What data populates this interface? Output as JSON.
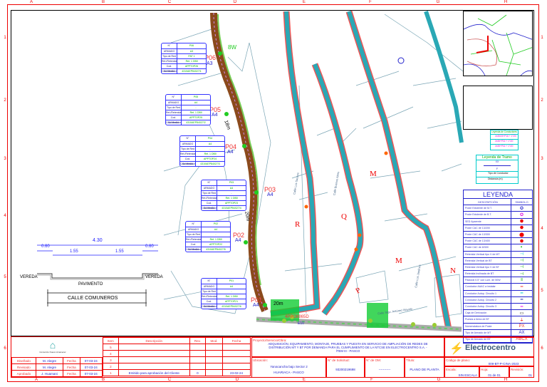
{
  "grid": {
    "columns": [
      "A",
      "B",
      "C",
      "D",
      "E",
      "F",
      "G",
      "H"
    ],
    "rows": [
      "1",
      "2",
      "3",
      "4",
      "5",
      "6"
    ]
  },
  "section": {
    "total": "4.30",
    "left_sidewalk": "0.60",
    "lane_left": "1.55",
    "lane_right": "1.55",
    "right_sidewalk": "0.60",
    "vereda_left": "VEREDA",
    "vereda_right": "VEREDA",
    "pavement": "PAVIMENTO",
    "street_name": "CALLE COMUNEROS"
  },
  "poles": [
    {
      "label": "P06",
      "armado": "A3",
      "n": "N°",
      "armado_h": "ARMADO",
      "rows": [
        [
          "Tipo de Red",
          "PAT 1"
        ],
        [
          "Ret./Retenida",
          "Ret. 1 DB0"
        ],
        [
          "Cod. Soterrado",
          "APPTOP26"
        ],
        [
          "Cod. Medidor",
          "4310AEP84027/1"
        ]
      ]
    },
    {
      "label": "P05",
      "armado": "A4",
      "n": "N°",
      "armado_h": "ARMADO",
      "rows": [
        [
          "Tipo de Red",
          "-"
        ],
        [
          "Ret./Retenida",
          "Ret. 1 DB0"
        ],
        [
          "Cod. Soterrado",
          "APPTOP25"
        ],
        [
          "Cod. Medidor",
          "4310AEP84027/2"
        ]
      ]
    },
    {
      "label": "P04",
      "armado": "A4",
      "n": "N°",
      "armado_h": "ARMADO",
      "rows": [
        [
          "Tipo de Red",
          "-"
        ],
        [
          "Ret./Retenida",
          "Ret. 1 DB0"
        ],
        [
          "Cod. Soterrado",
          "APPTOP24"
        ],
        [
          "Cod. Medidor",
          "4310AEP84027/3"
        ]
      ]
    },
    {
      "label": "P03",
      "armado": "A4",
      "n": "N°",
      "armado_h": "ARMADO",
      "rows": [
        [
          "Tipo de Red",
          "-"
        ],
        [
          "Ret./Retenida",
          "Ret. 1 DB0"
        ],
        [
          "Cod. Soterrado",
          "APPTOP23"
        ],
        [
          "Cod. Medidor",
          "4310AEP84027/4"
        ]
      ]
    },
    {
      "label": "P02",
      "armado": "A4",
      "n": "N°",
      "armado_h": "ARMADO",
      "rows": [
        [
          "Tipo de Red",
          "-"
        ],
        [
          "Ret./Retenida",
          "Ret. 1 DB0"
        ],
        [
          "Cod. Soterrado",
          "APPTOP22"
        ],
        [
          "Cod. Medidor",
          "4310AEP84027/5"
        ]
      ]
    },
    {
      "label": "P01",
      "armado": "A4",
      "n": "N°",
      "armado_h": "ARMADO",
      "rows": [
        [
          "Tipo de Red",
          "-"
        ],
        [
          "Ret./Retenida",
          "Ret. 1 DB0"
        ],
        [
          "Cod. Soterrado",
          "APPTOP21"
        ],
        [
          "Cod. Medidor",
          "4310AEP84027/6"
        ]
      ]
    }
  ],
  "map": {
    "distances": [
      "18m",
      "20m",
      "20m",
      "20m"
    ],
    "blocks": [
      "R",
      "Q",
      "M",
      "M",
      "P",
      "N"
    ],
    "streets": [
      "Calle Los Sauces",
      "Calle Buenos Aires",
      "Calle Los Jardines",
      "Calle Stgo. Antúnez Mayolo"
    ],
    "existing_pole": "4PPO8865D",
    "existing_armado": "E10",
    "cable_tag": "8W"
  },
  "cable_legend": {
    "title": "Leyenda de Conductores",
    "items": [
      "2x35/25+P16 + 1\"/20",
      "2x35+P16 + 1\"/20",
      "2x35+P16 + 1\"/20"
    ]
  },
  "terrain_legend": {
    "title": "Leyenda de Tramo",
    "top": "XX",
    "bottom": "F",
    "rows": [
      "Tipo de Conductor",
      "Distancia (m)"
    ]
  },
  "legend": {
    "title": "LEYENDA",
    "col_desc": "DESCRIPCIÓN",
    "col_sym": "SIMBOLO",
    "items": [
      {
        "d": "Poste Existente de M.T.",
        "s": "✪",
        "c": "#22c"
      },
      {
        "d": "Poste Existente de B.T.",
        "s": "✪",
        "c": "#d0d"
      },
      {
        "d": "SED Aparente",
        "s": "⬣",
        "c": "#e00"
      },
      {
        "d": "Poste CAC de 13/200",
        "s": "⬣",
        "c": "#e00"
      },
      {
        "d": "Poste CAC de 13/300",
        "s": "⬤",
        "c": "#e00"
      },
      {
        "d": "Poste CAC de 13/400",
        "s": "⬣",
        "c": "#e00"
      },
      {
        "d": "Poste CAC de 8/300",
        "s": "◐",
        "c": "#0b0"
      },
      {
        "d": "Retenida Vertical tipo V de MT",
        "s": "⊣",
        "c": "#0cc"
      },
      {
        "d": "Retenida Vertical de BT",
        "s": "⊣",
        "c": "#0a0"
      },
      {
        "d": "Retenida Vertical tipo V de BT",
        "s": "⊣",
        "c": "#0a0"
      },
      {
        "d": "Retenida Inclinada de BT",
        "s": "⊣",
        "c": "#0a0"
      },
      {
        "d": "Pastoral 0.5\" con Lum. de 50W",
        "s": "≡",
        "c": "#0a0"
      },
      {
        "d": "Conductor AAAC a instalar",
        "s": "━",
        "c": "#e33"
      },
      {
        "d": "Conductor Autop. Circuito 1",
        "s": "━",
        "c": "#0cc"
      },
      {
        "d": "Conductor Autop. Circuito 2",
        "s": "━",
        "c": "#22a"
      },
      {
        "d": "Conductor Autop. Circuito 3",
        "s": "━",
        "c": "#e0e"
      },
      {
        "d": "Caja de Derivación",
        "s": "▭",
        "c": "#000"
      },
      {
        "d": "Puesta a tierra de BT",
        "s": "⏚",
        "c": "#e00"
      },
      {
        "d": "Nomenclatura de Poste",
        "s": "PX",
        "c": "#e33"
      },
      {
        "d": "Tipo de Armado de MT",
        "s": "AX",
        "c": "#22c"
      },
      {
        "d": "Tipo de Armado de BT",
        "s": "ABCX",
        "c": "#e33"
      }
    ]
  },
  "title_block": {
    "logo_text": "Consorcio Nuevo Amanecer",
    "revisions_header": {
      "item": "Item",
      "desc": "Descripción",
      "rev": "Rev.",
      "mod": "Mod.",
      "date": "Fecha"
    },
    "revisions": [
      {
        "item": "5",
        "desc": "",
        "rev": "",
        "mod": "",
        "date": ""
      },
      {
        "item": "4",
        "desc": "",
        "rev": "",
        "mod": "",
        "date": ""
      },
      {
        "item": "3",
        "desc": "",
        "rev": "",
        "mod": "",
        "date": ""
      },
      {
        "item": "2",
        "desc": "",
        "rev": "",
        "mod": "",
        "date": ""
      },
      {
        "item": "1",
        "desc": "Emitido para aprobación del Cliente",
        "rev": "0",
        "mod": "",
        "date": "23-02-24"
      }
    ],
    "people": [
      {
        "role": "Diseñado",
        "name": "M. Alegre",
        "flabel": "Fecha",
        "date": "07-03-24"
      },
      {
        "role": "Revisado",
        "name": "M. Alegre",
        "flabel": "Fecha",
        "date": "07-03-24"
      },
      {
        "role": "Aprobado",
        "name": "J. Huamani",
        "flabel": "Fecha",
        "date": "07-03-24"
      }
    ],
    "project_label": "Proyecto/Servicio/Obra:",
    "project": "ADQUISICIÓN, EQUIPAMIENTO, MONTAJE, PRUEBAS Y PUESTA EN SERVICIO DE AMPLIACIÓN DE REDES DE DISTRIBUCIÓN MT Y BT POR DEMANDA PARA EL CUMPLIMIENTO DE LA NTCSE EN ELECTROCENTRO S.A. - ÍTEM III - PASCO",
    "company": "Electrocentro",
    "location_label": "Ubicación:",
    "location1": "Yanacancha bajo Sector 2",
    "location2": "HUARIACA - PASCO",
    "request_label": "N° de Solicitud:",
    "request": "93200219698",
    "om_label": "N° de OM:",
    "om": "-----------",
    "title_label": "Título:",
    "title": "PLANO DE PLANTA",
    "code_label": "Código de plano:",
    "code": "009-BT-P-CINA-2023",
    "scale_label": "Escala:",
    "scale": "SIN ESCALA",
    "sheet_label": "Hoja:",
    "sheet": "01 de 01",
    "revision_label": "Revisión:",
    "revision": "01"
  }
}
